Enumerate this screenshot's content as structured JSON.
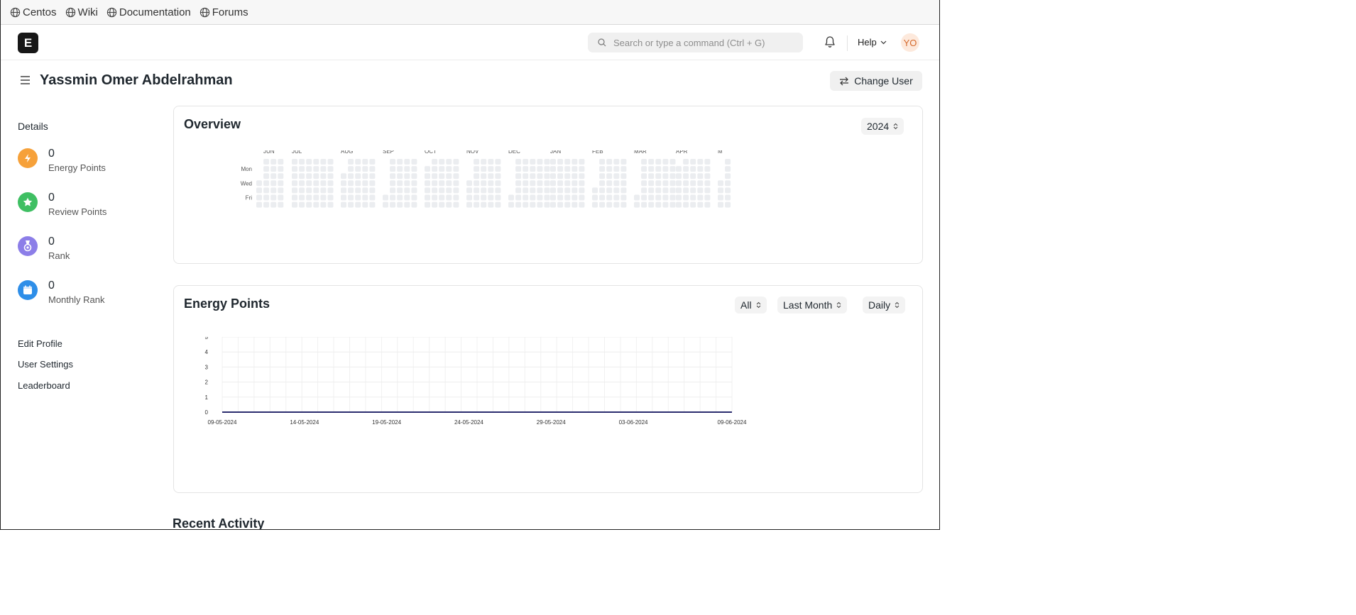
{
  "bookmarks": [
    "Centos",
    "Wiki",
    "Documentation",
    "Forums"
  ],
  "navbar": {
    "logo_letter": "E",
    "search_placeholder": "Search or type a command (Ctrl + G)",
    "help_label": "Help",
    "avatar_initials": "YO"
  },
  "page": {
    "title": "Yassmin Omer Abdelrahman",
    "change_user_label": "Change User"
  },
  "sidebar": {
    "heading": "Details",
    "stats": [
      {
        "value": "0",
        "label": "Energy Points",
        "color": "#f6a13a",
        "icon": "lightning-icon"
      },
      {
        "value": "0",
        "label": "Review Points",
        "color": "#3fbf63",
        "icon": "star-icon"
      },
      {
        "value": "0",
        "label": "Rank",
        "color": "#8c7ee8",
        "icon": "medal-icon"
      },
      {
        "value": "0",
        "label": "Monthly Rank",
        "color": "#2e8ee8",
        "icon": "calendar-icon"
      }
    ],
    "links": [
      "Edit Profile",
      "User Settings",
      "Leaderboard"
    ]
  },
  "overview": {
    "title": "Overview",
    "year": "2024",
    "months": [
      "JUN",
      "JUL",
      "AUG",
      "SEP",
      "OCT",
      "NOV",
      "DEC",
      "JAN",
      "FEB",
      "MAR",
      "APR",
      "M"
    ],
    "day_labels": [
      "Mon",
      "Wed",
      "Fri"
    ]
  },
  "energy": {
    "title": "Energy Points",
    "filter_user": "All",
    "filter_range": "Last Month",
    "filter_interval": "Daily"
  },
  "chart_data": {
    "type": "line",
    "title": "",
    "xlabel": "",
    "ylabel": "",
    "x_ticks": [
      "09-05-2024",
      "14-05-2024",
      "19-05-2024",
      "24-05-2024",
      "29-05-2024",
      "03-06-2024",
      "09-06-2024"
    ],
    "y_ticks": [
      "0",
      "1",
      "2",
      "3",
      "4",
      "5"
    ],
    "ylim": [
      0,
      5
    ],
    "x_range": [
      "09-05-2024",
      "09-06-2024"
    ],
    "series": [
      {
        "values": [
          0,
          0
        ]
      }
    ],
    "line_color": "#2b2d6e",
    "grid": true
  },
  "recent_activity": {
    "title": "Recent Activity"
  }
}
